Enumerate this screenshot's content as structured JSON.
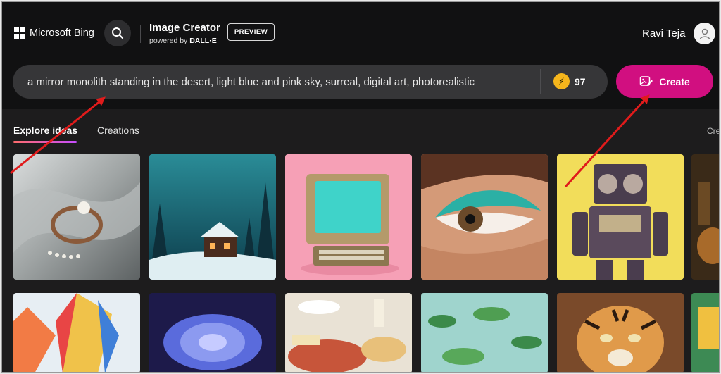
{
  "header": {
    "brand_label": "Microsoft Bing",
    "app_title": "Image Creator",
    "powered_by_prefix": "powered by",
    "powered_by_name": "DALL·E",
    "badge_label": "PREVIEW",
    "user_name": "Ravi Teja"
  },
  "prompt": {
    "value": "a mirror monolith standing in the desert, light blue and pink sky, surreal, digital art, photorealistic",
    "boost_count": "97",
    "create_label": "Create"
  },
  "tabs": [
    {
      "label": "Explore ideas",
      "active": true
    },
    {
      "label": "Creations",
      "active": false
    }
  ],
  "cut_off_link": "Cre",
  "icons": [
    "windows-logo-icon",
    "search-icon",
    "user-icon",
    "bolt-icon",
    "create-image-icon",
    "red-arrow-annotation"
  ],
  "colors": {
    "background": "#1d1c1d",
    "header": "#111112",
    "create_button": "#d10f80",
    "boost_coin": "#f5b51c",
    "annotation_arrow": "#e01b1b"
  }
}
